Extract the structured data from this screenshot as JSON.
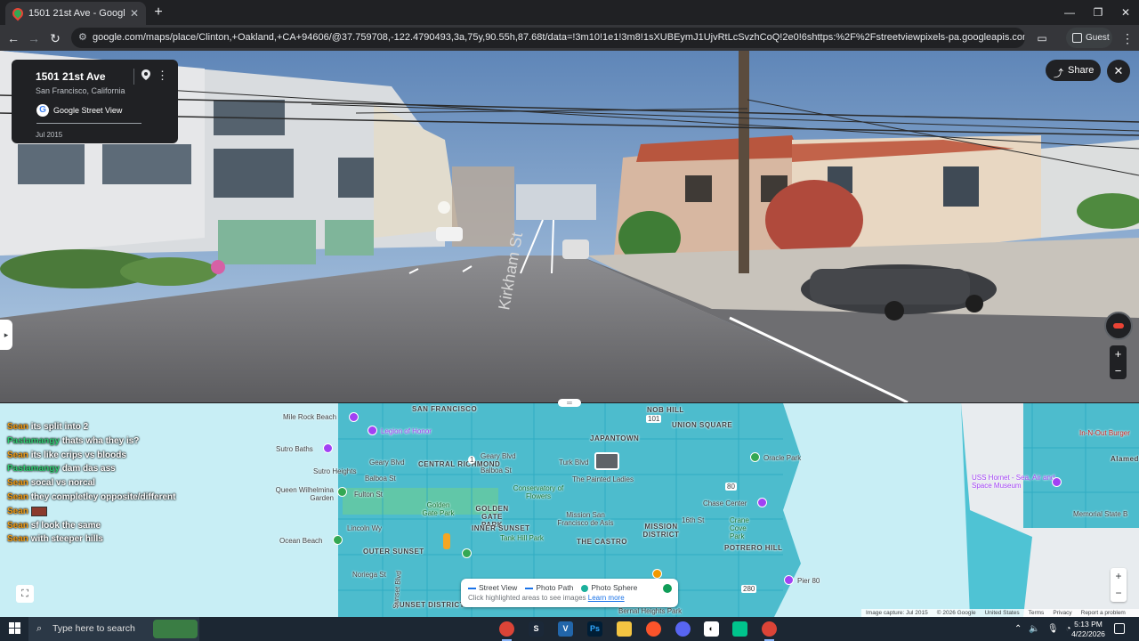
{
  "browser": {
    "tab_title": "1501 21st Ave - Google Maps",
    "tab_close": "✕",
    "new_tab": "+",
    "url": "google.com/maps/place/Clinton,+Oakland,+CA+94606/@37.759708,-122.4790493,3a,75y,90.55h,87.68t/data=!3m10!1e1!3m8!1sXUBEymJ1UjvRtLcSvzhCoQ!2e0!6shttps:%2F%2Fstreetviewpixels-pa.googleapis.com%2Fv1%2Fthumbnail%3Fcb_client%3...",
    "profile_label": "Guest",
    "back": "←",
    "forward": "→",
    "reload": "↻",
    "menu": "⋮"
  },
  "streetview": {
    "address": "1501 21st Ave",
    "city": "San Francisco, California",
    "source": "Google Street View",
    "date": "Jul 2015",
    "share_label": "Share",
    "close": "✕",
    "street_name": "Kirkham St"
  },
  "chat": [
    {
      "user": "Sean",
      "message": "its split into 2",
      "color": "orange"
    },
    {
      "user": "Pastamangy",
      "message": "thats wha they is?",
      "color": "green"
    },
    {
      "user": "Sean",
      "message": "its like crips vs bloods",
      "color": "orange"
    },
    {
      "user": "Pastamangy",
      "message": "dam das ass",
      "color": "green"
    },
    {
      "user": "Sean",
      "message": "socal vs norcal",
      "color": "orange"
    },
    {
      "user": "Sean",
      "message": "they completley opposite/different",
      "color": "orange"
    },
    {
      "user": "Sean",
      "message": "",
      "color": "orange",
      "image": true
    },
    {
      "user": "Sean",
      "message": "sf look the same",
      "color": "orange"
    },
    {
      "user": "Sean",
      "message": "with steeper hills",
      "color": "orange"
    }
  ],
  "map": {
    "labels": {
      "mile_rock": "Mile Rock Beach",
      "legion": "Legion of Honor",
      "sutro_baths": "Sutro Baths",
      "sutro_heights": "Sutro Heights",
      "central_richmond": "CENTRAL RICHMOND",
      "geary1": "Geary Blvd",
      "geary2": "Geary Blvd",
      "balboa1": "Balboa St",
      "balboa2": "Balboa St",
      "fulton": "Fulton St",
      "queen_wilhelmina": "Queen Wilhelmina Garden",
      "golden_gate_park": "Golden Gate Park",
      "golden_gate_park2": "GOLDEN GATE PARK",
      "lincoln": "Lincoln Wy",
      "inner_sunset": "INNER SUNSET",
      "outer_sunset": "OUTER SUNSET",
      "ocean_beach": "Ocean Beach",
      "noriega": "Noriega St",
      "sunset_district": "SUNSET DISTRICT",
      "sunset_blvd": "Sunset Blvd",
      "san_francisco": "SAN FRANCISCO",
      "nob_hill": "NOB HILL",
      "union_square": "UNION SQUARE",
      "japantown": "JAPANTOWN",
      "turk": "Turk Blvd",
      "painted_ladies": "The Painted Ladies",
      "conservatory": "Conservatory of Flowers",
      "mission_san_francisco": "Mission San Francisco de Asís",
      "the_castro": "THE CASTRO",
      "mission_district": "MISSION DISTRICT",
      "potrero_hill": "POTRERO HILL",
      "chase_center": "Chase Center",
      "crane_cove": "Crane Cove Park",
      "oracle_park": "Oracle Park",
      "tank_hill": "Tank Hill Park",
      "sixteenth": "16th St",
      "pier80": "Pier 80",
      "bernal": "Bernal Heights Park",
      "uss_hornet": "USS Hornet - Sea, Air and Space Museum",
      "in_n_out": "In-N-Out Burger",
      "alameda": "Alamed",
      "memorial": "Memorial State B",
      "route101": "101",
      "route1": "1",
      "route80": "80",
      "route280": "280"
    },
    "legend": {
      "street_view": "Street View",
      "photo_path": "Photo Path",
      "photo_sphere": "Photo Sphere",
      "hint": "Click highlighted areas to see images",
      "learn_more": "Learn more"
    },
    "attribution": {
      "capture": "Image capture: Jul 2015",
      "copyright": "© 2026 Google",
      "country": "United States",
      "terms": "Terms",
      "privacy": "Privacy",
      "report": "Report a problem"
    },
    "zoom_in": "+",
    "zoom_out": "−"
  },
  "taskbar": {
    "search_placeholder": "Type here to search",
    "time": "5:13 PM",
    "date": "4/22/2026"
  },
  "colors": {
    "map_water": "#4fc3d4",
    "sky": "#8fb3d6",
    "road": "#6f6f71"
  }
}
